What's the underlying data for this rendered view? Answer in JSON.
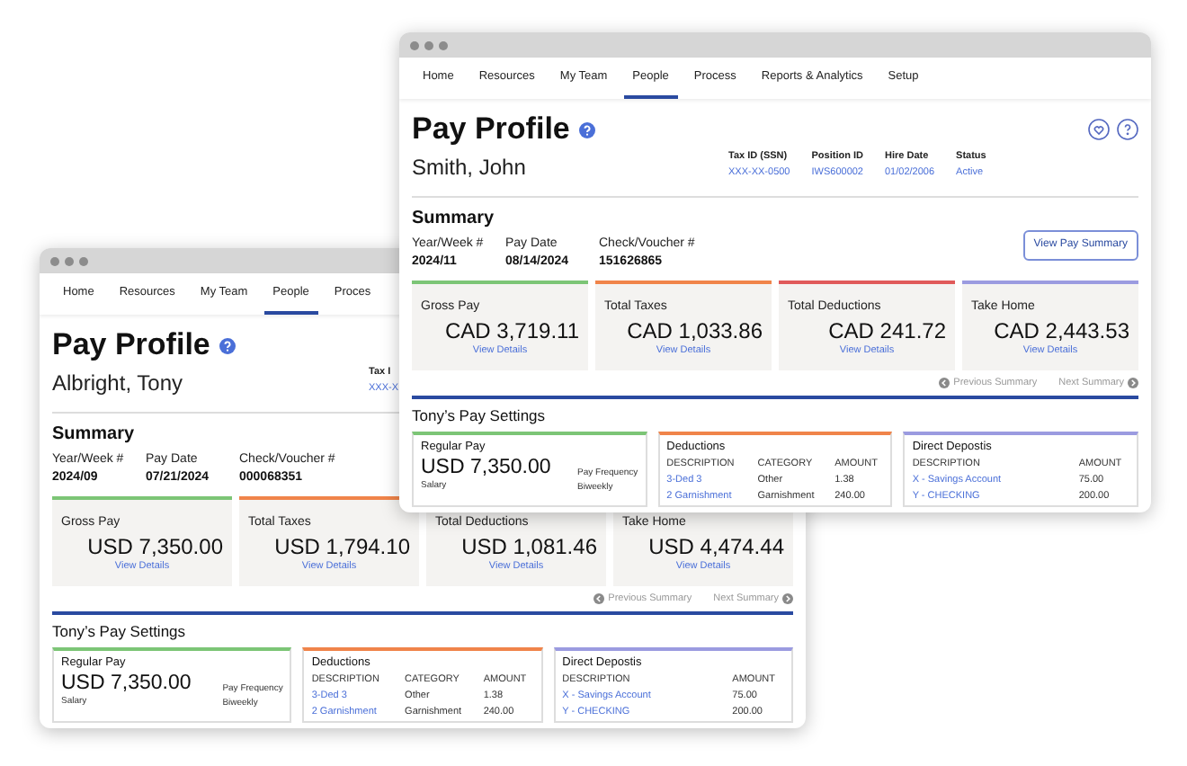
{
  "windows": [
    {
      "nav": [
        {
          "label": "Home",
          "selected": false
        },
        {
          "label": "Resources",
          "selected": false
        },
        {
          "label": "My Team",
          "selected": false
        },
        {
          "label": "People",
          "selected": true
        },
        {
          "label": "Proces",
          "selected": false
        }
      ],
      "title": "Pay Profile",
      "employee": "Albright, Tony",
      "ids": [
        {
          "label": "Tax I",
          "value": "XXX-X"
        }
      ],
      "summary": {
        "heading": "Summary",
        "fields": [
          {
            "label": "Year/Week #",
            "value": "2024/09"
          },
          {
            "label": "Pay Date",
            "value": "07/21/2024"
          },
          {
            "label": "Check/Voucher #",
            "value": "000068351"
          }
        ]
      },
      "cards": [
        {
          "label": "Gross Pay",
          "amount": "USD 7,350.00",
          "link": "View Details",
          "color": "#7cc576"
        },
        {
          "label": "Total Taxes",
          "amount": "USD 1,794.10",
          "link": "View Details",
          "color": "#f0844a"
        },
        {
          "label": "Total Deductions",
          "amount": "USD 1,081.46",
          "link": "View Details"
        },
        {
          "label": "Take Home",
          "amount": "USD 4,474.44",
          "link": "View Details"
        }
      ],
      "pager": {
        "previous": "Previous Summary",
        "next": "Next Summary"
      },
      "settings": {
        "heading": "Tony’s Pay Settings",
        "regular_pay": {
          "title": "Regular Pay",
          "amount": "USD 7,350.00",
          "type": "Salary",
          "frequency_label": "Pay Frequency",
          "frequency": "Biweekly"
        },
        "deductions": {
          "title": "Deductions",
          "columns": [
            "DESCRIPTION",
            "CATEGORY",
            "AMOUNT"
          ],
          "rows": [
            [
              "3-Ded 3",
              "Other",
              "1.38"
            ],
            [
              "2 Garnishment",
              "Garnishment",
              "240.00"
            ]
          ]
        },
        "deposits": {
          "title": "Direct Depostis",
          "columns": [
            "DESCRIPTION",
            "AMOUNT"
          ],
          "rows": [
            [
              "X - Savings Account",
              "75.00"
            ],
            [
              "Y - CHECKING",
              "200.00"
            ]
          ]
        }
      }
    },
    {
      "nav": [
        {
          "label": "Home",
          "selected": false
        },
        {
          "label": "Resources",
          "selected": false
        },
        {
          "label": "My Team",
          "selected": false
        },
        {
          "label": "People",
          "selected": true
        },
        {
          "label": "Process",
          "selected": false
        },
        {
          "label": "Reports & Analytics",
          "selected": false
        },
        {
          "label": "Setup",
          "selected": false
        }
      ],
      "title": "Pay Profile",
      "employee": "Smith, John",
      "header_icons": true,
      "ids": [
        {
          "label": "Tax ID (SSN)",
          "value": "XXX-XX-0500"
        },
        {
          "label": "Position ID",
          "value": "IWS600002"
        },
        {
          "label": "Hire Date",
          "value": "01/02/2006"
        },
        {
          "label": "Status",
          "value": "Active"
        }
      ],
      "summary": {
        "heading": "Summary",
        "fields": [
          {
            "label": "Year/Week #",
            "value": "2024/11"
          },
          {
            "label": "Pay Date",
            "value": "08/14/2024"
          },
          {
            "label": "Check/Voucher #",
            "value": "151626865"
          }
        ],
        "button": "View Pay Summary"
      },
      "cards": [
        {
          "label": "Gross Pay",
          "amount": "CAD 3,719.11",
          "link": "View Details",
          "color": "#7cc576"
        },
        {
          "label": "Total Taxes",
          "amount": "CAD 1,033.86",
          "link": "View Details",
          "color": "#f0844a"
        },
        {
          "label": "Total Deductions",
          "amount": "CAD 241.72",
          "link": "View Details",
          "color": "#e05a5a"
        },
        {
          "label": "Take Home",
          "amount": "CAD 2,443.53",
          "link": "View Details",
          "color": "#9b9be0"
        }
      ],
      "pager": {
        "previous": "Previous Summary",
        "next": "Next Summary"
      },
      "settings": {
        "heading": "Tony’s Pay Settings",
        "regular_pay": {
          "title": "Regular Pay",
          "amount": "USD 7,350.00",
          "type": "Salary",
          "frequency_label": "Pay Frequency",
          "frequency": "Biweekly"
        },
        "deductions": {
          "title": "Deductions",
          "columns": [
            "DESCRIPTION",
            "CATEGORY",
            "AMOUNT"
          ],
          "rows": [
            [
              "3-Ded 3",
              "Other",
              "1.38"
            ],
            [
              "2 Garnishment",
              "Garnishment",
              "240.00"
            ]
          ]
        },
        "deposits": {
          "title": "Direct Depostis",
          "columns": [
            "DESCRIPTION",
            "AMOUNT"
          ],
          "rows": [
            [
              "X - Savings Account",
              "75.00"
            ],
            [
              "Y - CHECKING",
              "200.00"
            ]
          ]
        }
      }
    }
  ]
}
